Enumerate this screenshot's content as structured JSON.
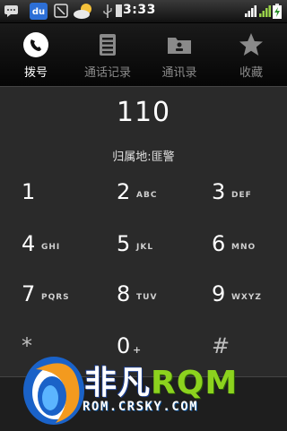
{
  "status_bar": {
    "time": "3:33",
    "icons": [
      "message-icon",
      "baidu-icon",
      "missed-call-icon",
      "weather-icon",
      "usb-icon",
      "sd-card-icon",
      "wifi-icon",
      "signal-icon",
      "battery-icon"
    ]
  },
  "tabs": [
    {
      "label": "拨号",
      "icon": "phone-icon",
      "active": true
    },
    {
      "label": "通话记录",
      "icon": "call-log-icon",
      "active": false
    },
    {
      "label": "通讯录",
      "icon": "contacts-icon",
      "active": false
    },
    {
      "label": "收藏",
      "icon": "star-icon",
      "active": false
    }
  ],
  "dialer": {
    "number": "110",
    "location": "归属地:匪警"
  },
  "keypad": [
    {
      "digit": "1",
      "letters": ""
    },
    {
      "digit": "2",
      "letters": "ABC"
    },
    {
      "digit": "3",
      "letters": "DEF"
    },
    {
      "digit": "4",
      "letters": "GHI"
    },
    {
      "digit": "5",
      "letters": "JKL"
    },
    {
      "digit": "6",
      "letters": "MNO"
    },
    {
      "digit": "7",
      "letters": "PQRS"
    },
    {
      "digit": "8",
      "letters": "TUV"
    },
    {
      "digit": "9",
      "letters": "WXYZ"
    },
    {
      "digit": "*",
      "letters": ""
    },
    {
      "digit": "0",
      "letters": "+"
    },
    {
      "digit": "#",
      "letters": ""
    }
  ],
  "watermark": {
    "brand_white": "非凡",
    "brand_green": "RQM",
    "url": "ROM.CRSKY.COM"
  },
  "colors": {
    "background": "#2a2a2a",
    "tab_bar": "#0a0a0a",
    "accent_green": "#8cd21e",
    "logo_blue": "#1a62c8"
  }
}
